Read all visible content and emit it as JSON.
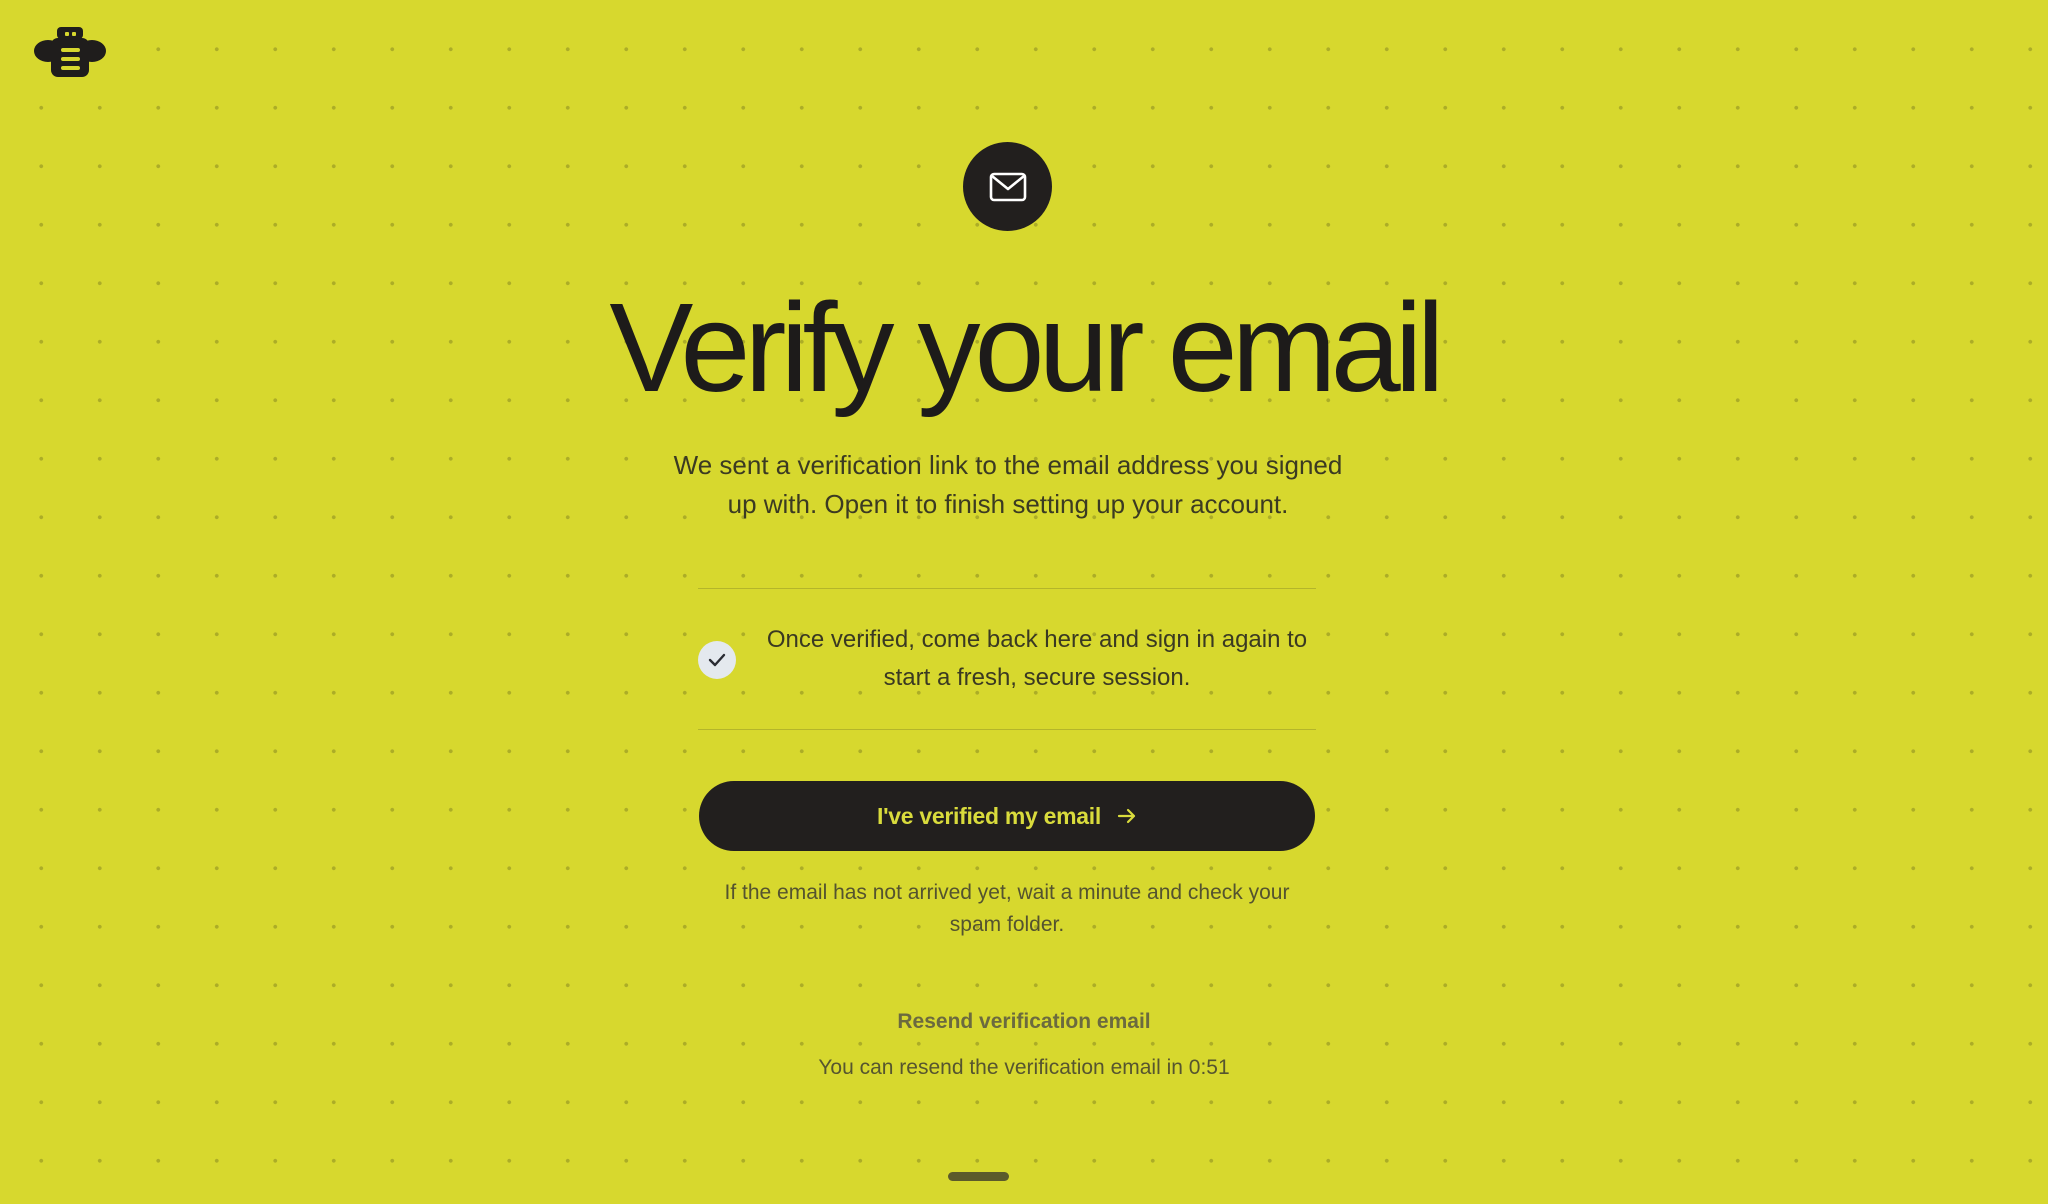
{
  "brand": {
    "logo_icon": "robot-mascot-icon"
  },
  "header": {
    "badge_icon": "mail-icon",
    "title": "Verify your email",
    "subtitle": "We sent a verification link to the email address you signed up with. Open it to finish setting up your account."
  },
  "note": {
    "icon": "check-icon",
    "text": "Once verified, come back here and sign in again to start a fresh, secure session."
  },
  "actions": {
    "primary_label": "I've verified my email",
    "primary_icon": "arrow-right-icon",
    "hint": "If the email has not arrived yet, wait a minute and check your spam folder.",
    "resend_label": "Resend verification email",
    "resend_timer": "You can resend the verification email in 0:51"
  },
  "colors": {
    "background": "#d7d82e",
    "dark": "#221f1e",
    "button_text": "#d9db3c"
  }
}
